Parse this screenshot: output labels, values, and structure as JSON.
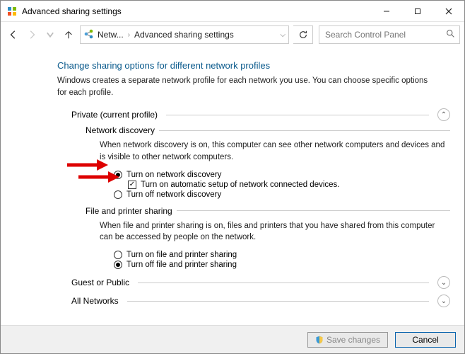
{
  "window": {
    "title": "Advanced sharing settings"
  },
  "breadcrumb": {
    "item1": "Netw...",
    "item2": "Advanced sharing settings"
  },
  "search": {
    "placeholder": "Search Control Panel"
  },
  "page": {
    "heading": "Change sharing options for different network profiles",
    "description": "Windows creates a separate network profile for each network you use. You can choose specific options for each profile."
  },
  "sections": {
    "private": {
      "label": "Private (current profile)",
      "network_discovery": {
        "title": "Network discovery",
        "desc": "When network discovery is on, this computer can see other network computers and devices and is visible to other network computers.",
        "opt_on": "Turn on network discovery",
        "opt_auto": "Turn on automatic setup of network connected devices.",
        "opt_off": "Turn off network discovery"
      },
      "file_printer": {
        "title": "File and printer sharing",
        "desc": "When file and printer sharing is on, files and printers that you have shared from this computer can be accessed by people on the network.",
        "opt_on": "Turn on file and printer sharing",
        "opt_off": "Turn off file and printer sharing"
      }
    },
    "guest": {
      "label": "Guest or Public"
    },
    "all": {
      "label": "All Networks"
    }
  },
  "buttons": {
    "save": "Save changes",
    "cancel": "Cancel"
  }
}
